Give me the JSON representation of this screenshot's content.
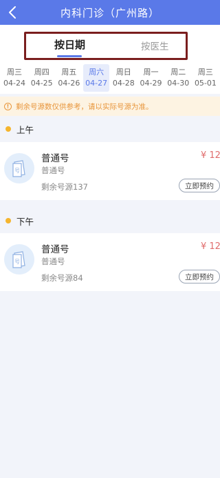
{
  "header": {
    "title": "内科门诊（广州路）"
  },
  "tabs": [
    {
      "label": "按日期",
      "active": true
    },
    {
      "label": "按医生",
      "active": false
    }
  ],
  "dates": [
    {
      "dow": "周三",
      "day": "04-24"
    },
    {
      "dow": "周四",
      "day": "04-25"
    },
    {
      "dow": "周五",
      "day": "04-26"
    },
    {
      "dow": "周六",
      "day": "04-27",
      "selected": true
    },
    {
      "dow": "周日",
      "day": "04-28"
    },
    {
      "dow": "周一",
      "day": "04-29"
    },
    {
      "dow": "周二",
      "day": "04-30"
    },
    {
      "dow": "周三",
      "day": "05-01"
    }
  ],
  "notice": {
    "text": "剩余号源数仅供参考，请以实际号源为准。"
  },
  "sessions": [
    {
      "label": "上午",
      "slot": {
        "title": "普通号",
        "subtitle": "普通号",
        "remaining": "剩余号源137",
        "price": "¥ 12",
        "action": "立即预约"
      }
    },
    {
      "label": "下午",
      "slot": {
        "title": "普通号",
        "subtitle": "普通号",
        "remaining": "剩余号源84",
        "price": "¥ 12",
        "action": "立即预约"
      }
    }
  ],
  "colors": {
    "primary": "#5a79e8",
    "price": "#e06d6d",
    "notice": "#e8963c",
    "dot": "#f5b52e",
    "highlight_box": "#7a1e1e"
  }
}
